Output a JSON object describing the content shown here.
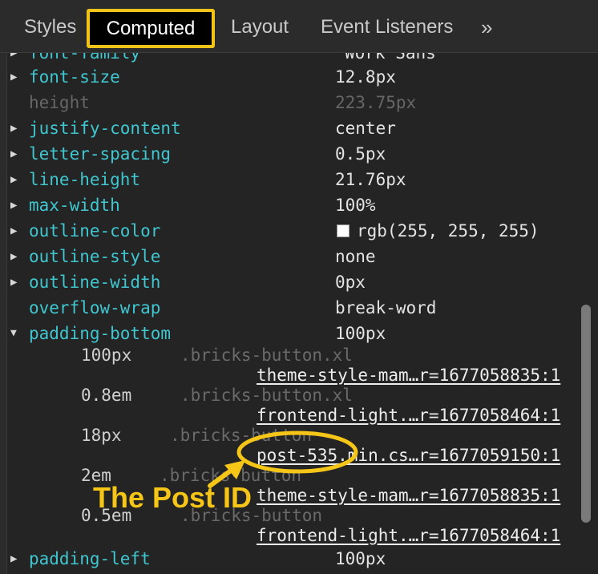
{
  "tabs": {
    "styles": "Styles",
    "computed": "Computed",
    "layout": "Layout",
    "event_listeners": "Event Listeners",
    "more": "»"
  },
  "properties": [
    {
      "name": "font-family",
      "value": "Work Sans",
      "expandable": true,
      "dim": false
    },
    {
      "name": "font-size",
      "value": "12.8px",
      "expandable": true,
      "dim": false
    },
    {
      "name": "height",
      "value": "223.75px",
      "expandable": false,
      "dim": true
    },
    {
      "name": "justify-content",
      "value": "center",
      "expandable": true,
      "dim": false
    },
    {
      "name": "letter-spacing",
      "value": "0.5px",
      "expandable": true,
      "dim": false
    },
    {
      "name": "line-height",
      "value": "21.76px",
      "expandable": true,
      "dim": false
    },
    {
      "name": "max-width",
      "value": "100%",
      "expandable": true,
      "dim": false
    },
    {
      "name": "outline-color",
      "value": "rgb(255, 255, 255)",
      "expandable": true,
      "dim": false
    },
    {
      "name": "outline-style",
      "value": "none",
      "expandable": true,
      "dim": false
    },
    {
      "name": "outline-width",
      "value": "0px",
      "expandable": true,
      "dim": false
    },
    {
      "name": "overflow-wrap",
      "value": "break-word",
      "expandable": false,
      "dim": false
    },
    {
      "name": "padding-bottom",
      "value": "100px",
      "expandable": true,
      "expanded": true,
      "dim": false
    }
  ],
  "padding_bottom_sources": [
    {
      "value": "100px",
      "selector": ".bricks-button.xl",
      "file": "theme-style-mam…r=1677058835:1"
    },
    {
      "value": "0.8em",
      "selector": ".bricks-button.xl",
      "file": "frontend-light.…r=1677058464:1"
    },
    {
      "value": "18px",
      "selector": ".bricks-button",
      "file": "post-535.min.cs…r=1677059150:1"
    },
    {
      "value": "2em",
      "selector": ".bricks-button",
      "file": "theme-style-mam…r=1677058835:1"
    },
    {
      "value": "0.5em",
      "selector": ".bricks-button",
      "file": "frontend-light.…r=1677058464:1"
    }
  ],
  "last_property": {
    "name": "padding-left",
    "value": "100px"
  },
  "annotation": {
    "label": "The Post ID",
    "color": "#f5c518"
  },
  "colors": {
    "property_name": "#3fc6cf",
    "accent": "#f2c418",
    "background": "#242424"
  }
}
